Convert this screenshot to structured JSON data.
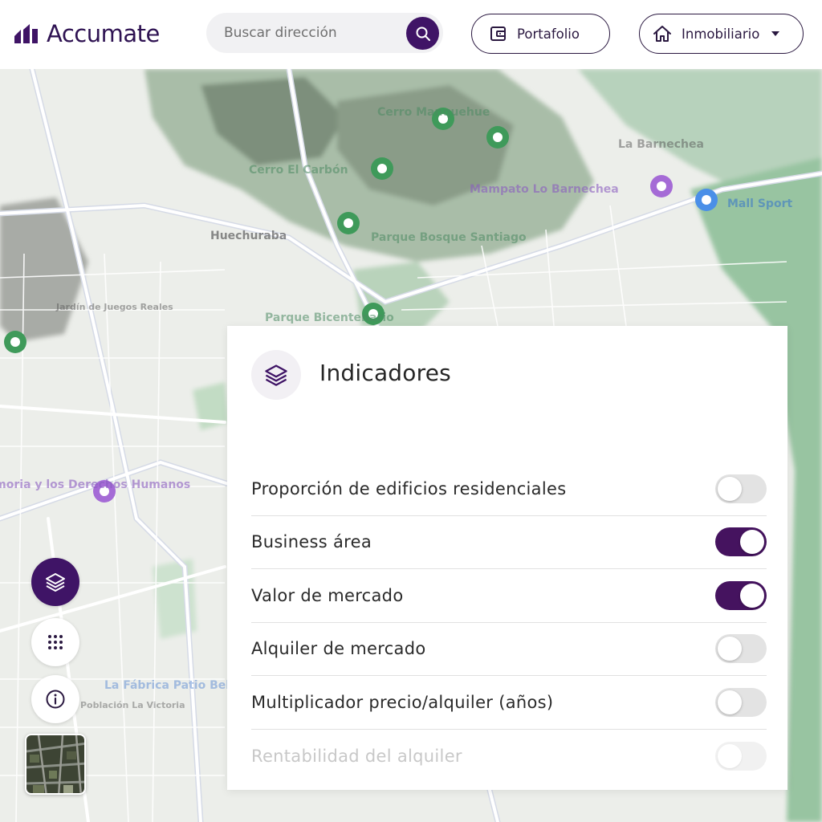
{
  "header": {
    "brand": "Accumate",
    "search": {
      "placeholder": "Buscar dirección",
      "value": ""
    },
    "portfolio_label": "Portafolio",
    "property_type_label": "Inmobiliario"
  },
  "icons": {
    "logo": "accumate-logo-icon",
    "search": "search-icon",
    "portfolio": "wallet-icon",
    "property_type": "home-icon",
    "dropdown": "caret-down-icon",
    "layers": "layers-icon",
    "grid": "grid-icon",
    "info": "info-icon"
  },
  "map": {
    "labels": [
      "Cerro Manquehue",
      "Cerro El Carbón",
      "Mampato Lo Barnechea",
      "Mall Sport",
      "Huechuraba",
      "Parque Bicentenario",
      "Parque Bosque Santiago",
      "La Barnechea",
      "Museo de la Memoria y los Derechos Humanos",
      "La Fábrica Patio Bellavista",
      "Jardín de Juegos Reales",
      "Población La Victoria"
    ]
  },
  "indicators": {
    "title": "Indicadores",
    "items": [
      {
        "label": "Proporción de edificios residenciales",
        "enabled": false
      },
      {
        "label": "Business área",
        "enabled": true
      },
      {
        "label": "Valor de mercado",
        "enabled": true
      },
      {
        "label": "Alquiler de mercado",
        "enabled": false
      },
      {
        "label": "Multiplicador precio/alquiler (años)",
        "enabled": false
      },
      {
        "label": "Rentabilidad del alquiler",
        "enabled": false
      }
    ]
  },
  "colors": {
    "brand": "#3f1466",
    "toggle_on": "#45135f",
    "toggle_off": "#e3e3e3",
    "map_park": "#8fbf99",
    "map_road": "#ffffff"
  }
}
